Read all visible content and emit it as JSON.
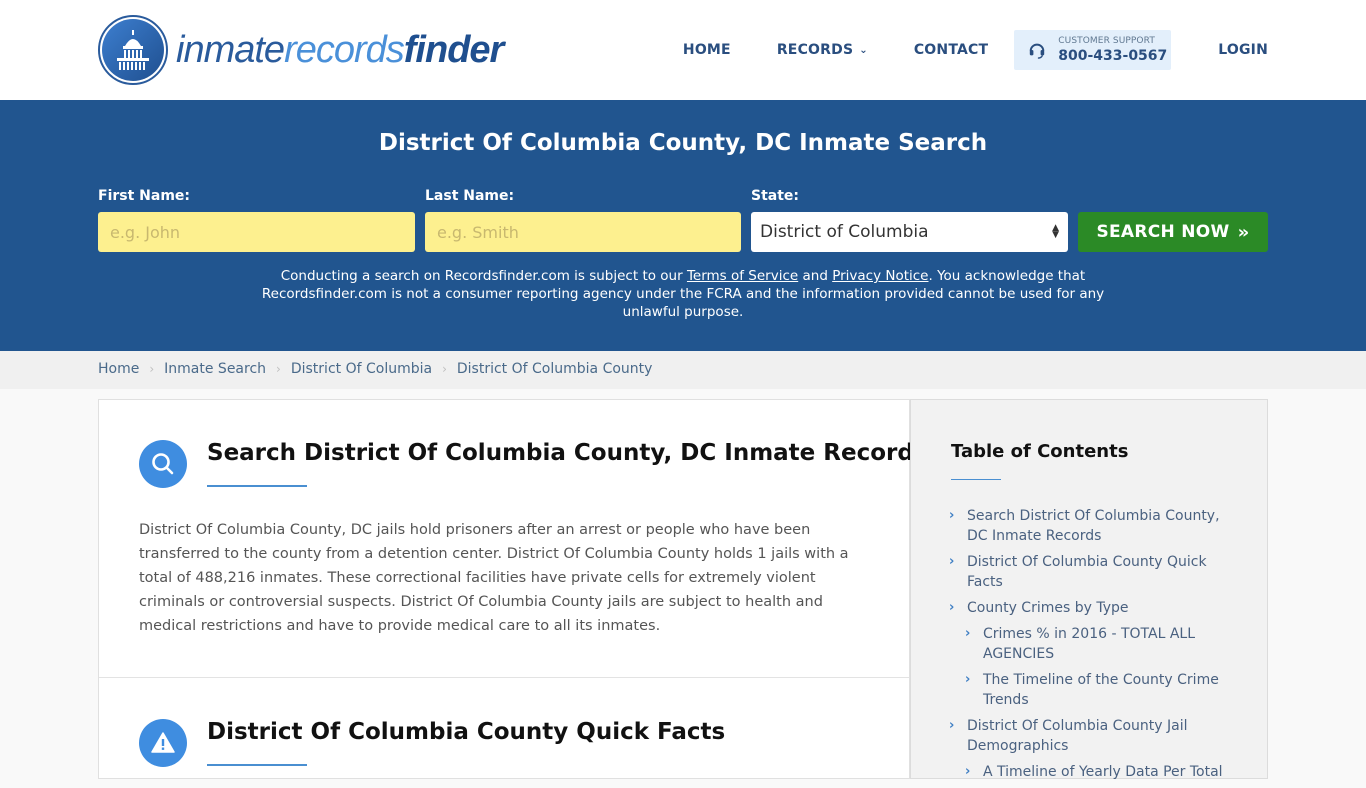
{
  "header": {
    "logo": {
      "part1": "inmate",
      "part2": "records",
      "part3": "finder"
    },
    "nav": [
      {
        "label": "HOME"
      },
      {
        "label": "RECORDS"
      },
      {
        "label": "CONTACT"
      }
    ],
    "support": {
      "label": "CUSTOMER SUPPORT",
      "phone": "800-433-0567"
    },
    "login": "LOGIN"
  },
  "search": {
    "title": "District Of Columbia County, DC Inmate Search",
    "first_name": {
      "label": "First Name:",
      "placeholder": "e.g. John",
      "value": ""
    },
    "last_name": {
      "label": "Last Name:",
      "placeholder": "e.g. Smith",
      "value": ""
    },
    "state": {
      "label": "State:",
      "selected": "District of Columbia"
    },
    "button": "SEARCH NOW",
    "disclaimer": {
      "prefix": "Conducting a search on Recordsfinder.com is subject to our ",
      "terms": "Terms of Service",
      "and": " and ",
      "privacy": "Privacy Notice",
      "suffix": ". You acknowledge that Recordsfinder.com is not a consumer reporting agency under the FCRA and the information provided cannot be used for any unlawful purpose."
    }
  },
  "breadcrumb": [
    "Home",
    "Inmate Search",
    "District Of Columbia",
    "District Of Columbia County"
  ],
  "main": {
    "sections": [
      {
        "icon": "search-icon",
        "title": "Search District Of Columbia County, DC Inmate Records",
        "body": "District Of Columbia County, DC jails hold prisoners after an arrest or people who have been transferred to the county from a detention center. District Of Columbia County holds 1 jails with a total of 488,216 inmates. These correctional facilities have private cells for extremely violent criminals or controversial suspects. District Of Columbia County jails are subject to health and medical restrictions and have to provide medical care to all its inmates."
      },
      {
        "icon": "warning-icon",
        "title": "District Of Columbia County Quick Facts"
      }
    ]
  },
  "toc": {
    "title": "Table of Contents",
    "items": [
      {
        "label": "Search District Of Columbia County, DC Inmate Records",
        "level": 1
      },
      {
        "label": "District Of Columbia County Quick Facts",
        "level": 1
      },
      {
        "label": "County Crimes by Type",
        "level": 1
      },
      {
        "label": "Crimes % in 2016 - TOTAL ALL AGENCIES",
        "level": 2
      },
      {
        "label": "The Timeline of the County Crime Trends",
        "level": 2
      },
      {
        "label": "District Of Columbia County Jail Demographics",
        "level": 1
      },
      {
        "label": "A Timeline of Yearly Data Per Total",
        "level": 2
      }
    ]
  },
  "colors": {
    "brand_blue": "#21558f",
    "accent_blue": "#3f8de0",
    "button_green": "#2b8a26",
    "input_yellow": "#fdf08f"
  }
}
